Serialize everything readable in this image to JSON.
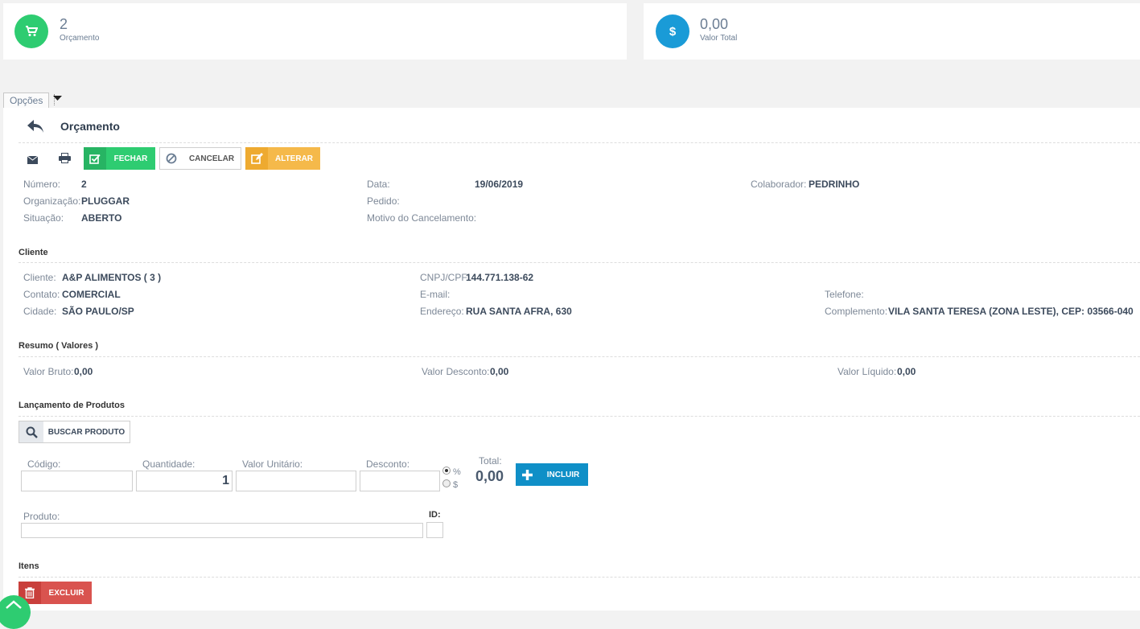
{
  "summary_cards": [
    {
      "value": "2",
      "label": "Orçamento",
      "icon": "cart-icon",
      "color": "#2ecc71"
    },
    {
      "value": "0,00",
      "label": "Valor Total",
      "icon": "dollar-icon",
      "color": "#1a9bd7"
    }
  ],
  "options_tab": {
    "label": "Opções"
  },
  "header": {
    "title": "Orçamento"
  },
  "toolbar": {
    "fechar_label": "FECHAR",
    "cancelar_label": "CANCELAR",
    "alterar_label": "ALTERAR",
    "colors": {
      "fechar": "#2ecc71",
      "alterar": "#f5b94a",
      "cancelar_border": "#cfcfcf"
    }
  },
  "info": {
    "numero": {
      "label": "Número:",
      "value": "2"
    },
    "organizacao": {
      "label": "Organização:",
      "value": "PLUGGAR"
    },
    "situacao": {
      "label": "Situação:",
      "value": "ABERTO"
    },
    "data": {
      "label": "Data:",
      "value": "19/06/2019"
    },
    "pedido": {
      "label": "Pedido:",
      "value": ""
    },
    "motivo": {
      "label": "Motivo do Cancelamento:",
      "value": ""
    },
    "colaborador": {
      "label": "Colaborador:",
      "value": "PEDRINHO"
    }
  },
  "cliente": {
    "section_title": "Cliente",
    "cliente": {
      "label": "Cliente:",
      "value": "A&P ALIMENTOS ( 3 )"
    },
    "contato": {
      "label": "Contato:",
      "value": "COMERCIAL"
    },
    "cidade": {
      "label": "Cidade:",
      "value": "SÃO PAULO/SP"
    },
    "cnpj": {
      "label": "CNPJ/CPF:",
      "value": "144.771.138-62"
    },
    "email": {
      "label": "E-mail:",
      "value": ""
    },
    "endereco": {
      "label": "Endereço:",
      "value": "RUA SANTA AFRA, 630"
    },
    "telefone": {
      "label": "Telefone:",
      "value": ""
    },
    "complemento": {
      "label": "Complemento:",
      "value": "VILA SANTA TERESA (ZONA LESTE), CEP: 03566-040"
    }
  },
  "resumo": {
    "section_title": "Resumo ( Valores )",
    "bruto": {
      "label": "Valor Bruto:",
      "value": "0,00"
    },
    "desconto": {
      "label": "Valor Desconto:",
      "value": "0,00"
    },
    "liquido": {
      "label": "Valor Líquido:",
      "value": "0,00"
    }
  },
  "lancamento": {
    "section_title": "Lançamento de Produtos",
    "buscar_label": "BUSCAR PRODUTO",
    "codigo_label": "Código:",
    "quantidade_label": "Quantidade:",
    "quantidade_value": "1",
    "valor_unitario_label": "Valor Unitário:",
    "desconto_label": "Desconto:",
    "radio_percent": "%",
    "radio_dollar": "$",
    "total_label": "Total:",
    "total_value": "0,00",
    "incluir_label": "INCLUIR",
    "produto_label": "Produto:",
    "id_label": "ID:"
  },
  "itens": {
    "section_title": "Itens",
    "excluir_label": "EXCLUIR",
    "excluir_color": "#d9534f"
  }
}
